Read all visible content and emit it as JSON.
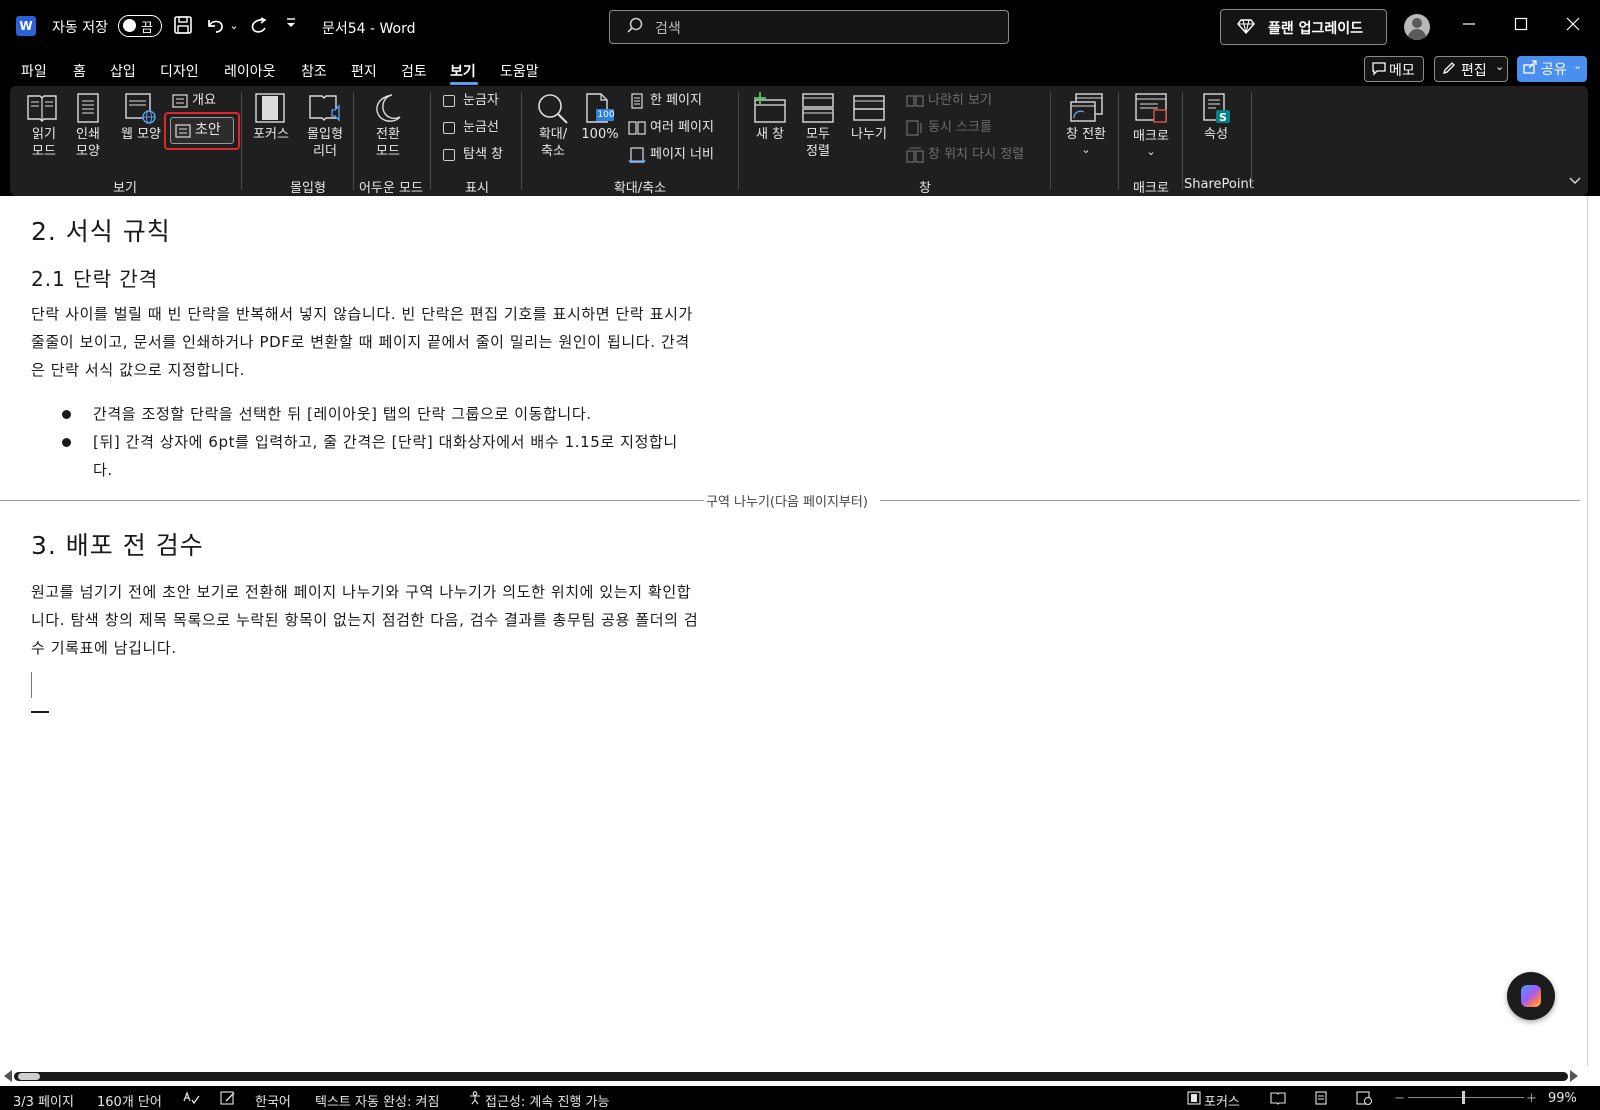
{
  "titlebar": {
    "app_icon_letter": "W",
    "autosave_label": "자동 저장",
    "autosave_state": "끔",
    "document_title": "문서54  -  Word",
    "search_placeholder": "검색",
    "upgrade_label": "플랜 업그레이드",
    "window_buttons": [
      "minimize-icon",
      "maximize-icon",
      "close-icon"
    ]
  },
  "tabs": {
    "items": [
      "파일",
      "홈",
      "삽입",
      "디자인",
      "레이아웃",
      "참조",
      "편지",
      "검토",
      "보기",
      "도움말"
    ],
    "active": "보기",
    "memo_label": "메모",
    "edit_label": "편집",
    "share_label": "공유"
  },
  "ribbon": {
    "groups": {
      "view": "보기",
      "immersive": "몰입형",
      "dark_mode": "어두운 모드",
      "show": "표시",
      "zoom": "확대/축소",
      "window": "창",
      "macro": "매크로",
      "sharepoint": "SharePoint"
    },
    "view": {
      "read_mode": [
        "읽기",
        "모드"
      ],
      "print_layout": [
        "인쇄",
        "모양"
      ],
      "web_layout": "웹 모양",
      "outline": "개요",
      "draft": "초안"
    },
    "immersive": {
      "focus": "포커스",
      "immersive_reader": [
        "몰입형",
        "리더"
      ]
    },
    "dark_mode": {
      "switch_mode": [
        "전환",
        "모드"
      ]
    },
    "show": {
      "ruler": "눈금자",
      "gridlines": "눈금선",
      "navigation_pane": "탐색 창"
    },
    "zoom": {
      "zoom": [
        "확대/",
        "축소"
      ],
      "hundred": "100%",
      "hundred_badge": "100",
      "one_page": "한 페이지",
      "multiple_pages": "여러 페이지",
      "page_width": "페이지 너비"
    },
    "window": {
      "new_window": "새 창",
      "arrange_all": [
        "모두",
        "정렬"
      ],
      "split": "나누기",
      "side_by_side": "나란히 보기",
      "sync_scroll": "동시 스크롤",
      "reset_position": "창 위치 다시 정렬",
      "switch_windows": "창 전환"
    },
    "macro": {
      "macros": "매크로"
    },
    "sharepoint": {
      "properties": "속성"
    }
  },
  "document": {
    "h1_a": "2. 서식 규칙",
    "h2_a": "2.1 단락 간격",
    "para_1": "단락 사이를 벌릴 때 빈 단락을 반복해서 넣지 않습니다. 빈 단락은 편집 기호를 표시하면 단락 표시가 줄줄이 보이고, 문서를 인쇄하거나 PDF로 변환할 때 페이지 끝에서 줄이 밀리는 원인이 됩니다. 간격은 단락 서식 값으로 지정합니다.",
    "bullets": [
      "간격을 조정할 단락을 선택한 뒤 [레이아웃] 탭의 단락 그룹으로 이동합니다.",
      "[뒤] 간격 상자에 6pt를 입력하고, 줄 간격은 [단락] 대화상자에서 배수 1.15로 지정합니다."
    ],
    "section_break": "구역 나누기(다음 페이지부터)",
    "h1_b": "3. 배포 전 검수",
    "para_2": "원고를 넘기기 전에 초안 보기로 전환해 페이지 나누기와 구역 나누기가 의도한 위치에 있는지 확인합니다. 탐색 창의 제목 목록으로 누락된 항목이 없는지 점검한 다음, 검수 결과를 총무팀 공용 폴더의 검수 기록표에 남깁니다."
  },
  "statusbar": {
    "page": "3/3 페이지",
    "words": "160개 단어",
    "language": "한국어",
    "autocomplete": "텍스트 자동 완성: 켜짐",
    "accessibility": "접근성: 계속 진행 가능",
    "focus": "포커스",
    "zoom_level": "99%",
    "zoom_fraction": 0.99
  },
  "colors": {
    "accent": "#5a9cf8",
    "share": "#4a8ef0",
    "highlight": "#e0262c",
    "ribbon_bg": "#1f1f1f"
  }
}
